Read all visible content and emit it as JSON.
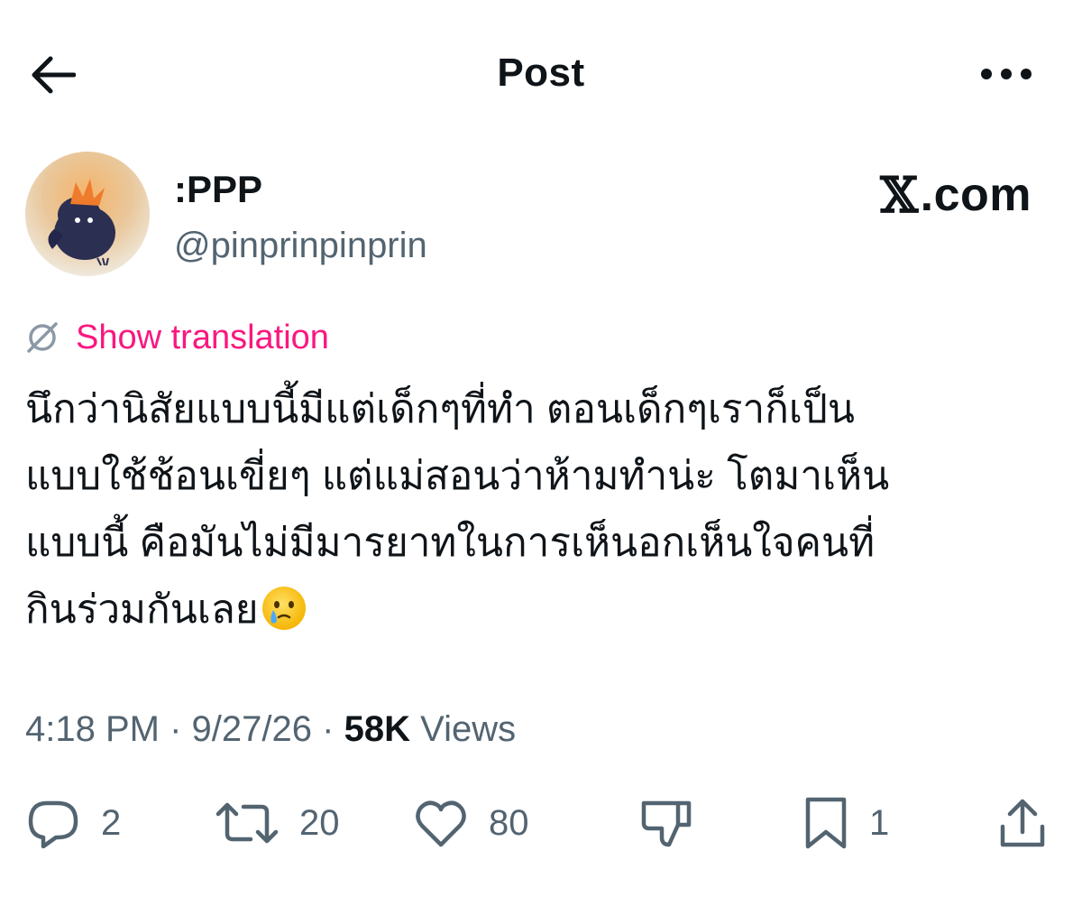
{
  "header": {
    "title": "Post",
    "back_icon": "back-arrow-icon",
    "more_icon": "more-options-icon"
  },
  "author": {
    "display_name": ":PPP",
    "handle": "@pinprinpinprin"
  },
  "brand": {
    "mark": "𝕏",
    "text": ".com"
  },
  "translate": {
    "label": "Show translation",
    "icon": "translate-icon",
    "color": "#f91880"
  },
  "tweet": {
    "lines": [
      "นึกว่านิสัยแบบนี้มีแต่เด็กๆที่ทำ ตอนเด็กๆเราก็เป็น",
      "แบบใช้ช้อนเขี่ยๆ แต่แม่สอนว่าห้ามทำน่ะ โตมาเห็น",
      "แบบนี้ คือมันไม่มีมารยาทในการเห็นอกเห็นใจคนที่",
      "กินร่วมกันเลย"
    ],
    "emoji": "face-holding-back-tears-icon"
  },
  "meta": {
    "time": "4:18 PM",
    "separator": "·",
    "date": "9/27/26",
    "views_count": "58K",
    "views_label": "Views"
  },
  "actions": {
    "replies": "2",
    "reposts": "20",
    "likes": "80",
    "bookmarks": "1"
  },
  "colors": {
    "text": "#0f1419",
    "secondary": "#536471",
    "accent": "#f91880"
  }
}
